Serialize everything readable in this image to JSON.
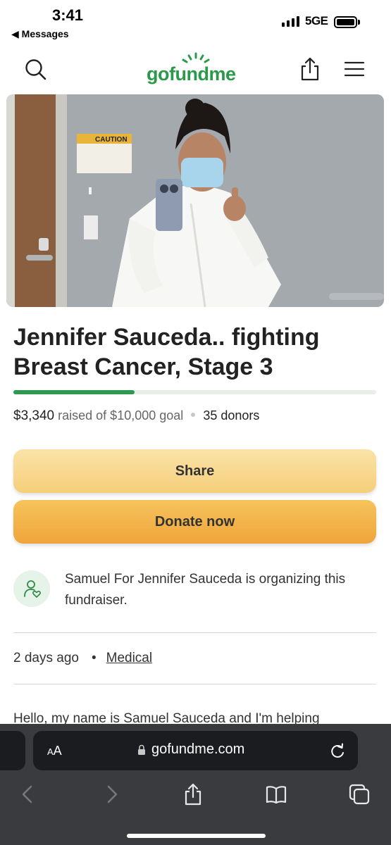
{
  "status_bar": {
    "time": "3:41",
    "back_label": "◀ Messages",
    "network": "5GE"
  },
  "nav": {
    "logo": "gofundme",
    "icons": [
      "search-icon",
      "share-icon",
      "menu-icon"
    ],
    "brand_color": "#2a9a4a"
  },
  "campaign": {
    "title": "Jennifer Sauceda.. fighting Breast Cancer, Stage 3",
    "raised": "$3,340",
    "raised_of_goal": "raised of $10,000 goal",
    "donors": "35 donors",
    "progress_fraction": 0.334,
    "share_label": "Share",
    "donate_label": "Donate now",
    "organizer_text": "Samuel For Jennifer Sauceda is organizing this fundraiser.",
    "created": "2 days ago",
    "bullet": "•",
    "category": "Medical",
    "story_preview": "Hello, my name is Samuel Sauceda and I'm helping"
  },
  "hero_image": {
    "sign_text": "CAUTION"
  },
  "browser": {
    "text_size_label": "AA",
    "url": "gofundme.com",
    "toolbar_icons": [
      "back-icon",
      "forward-icon",
      "share-icon",
      "bookmarks-icon",
      "tabs-icon"
    ]
  }
}
